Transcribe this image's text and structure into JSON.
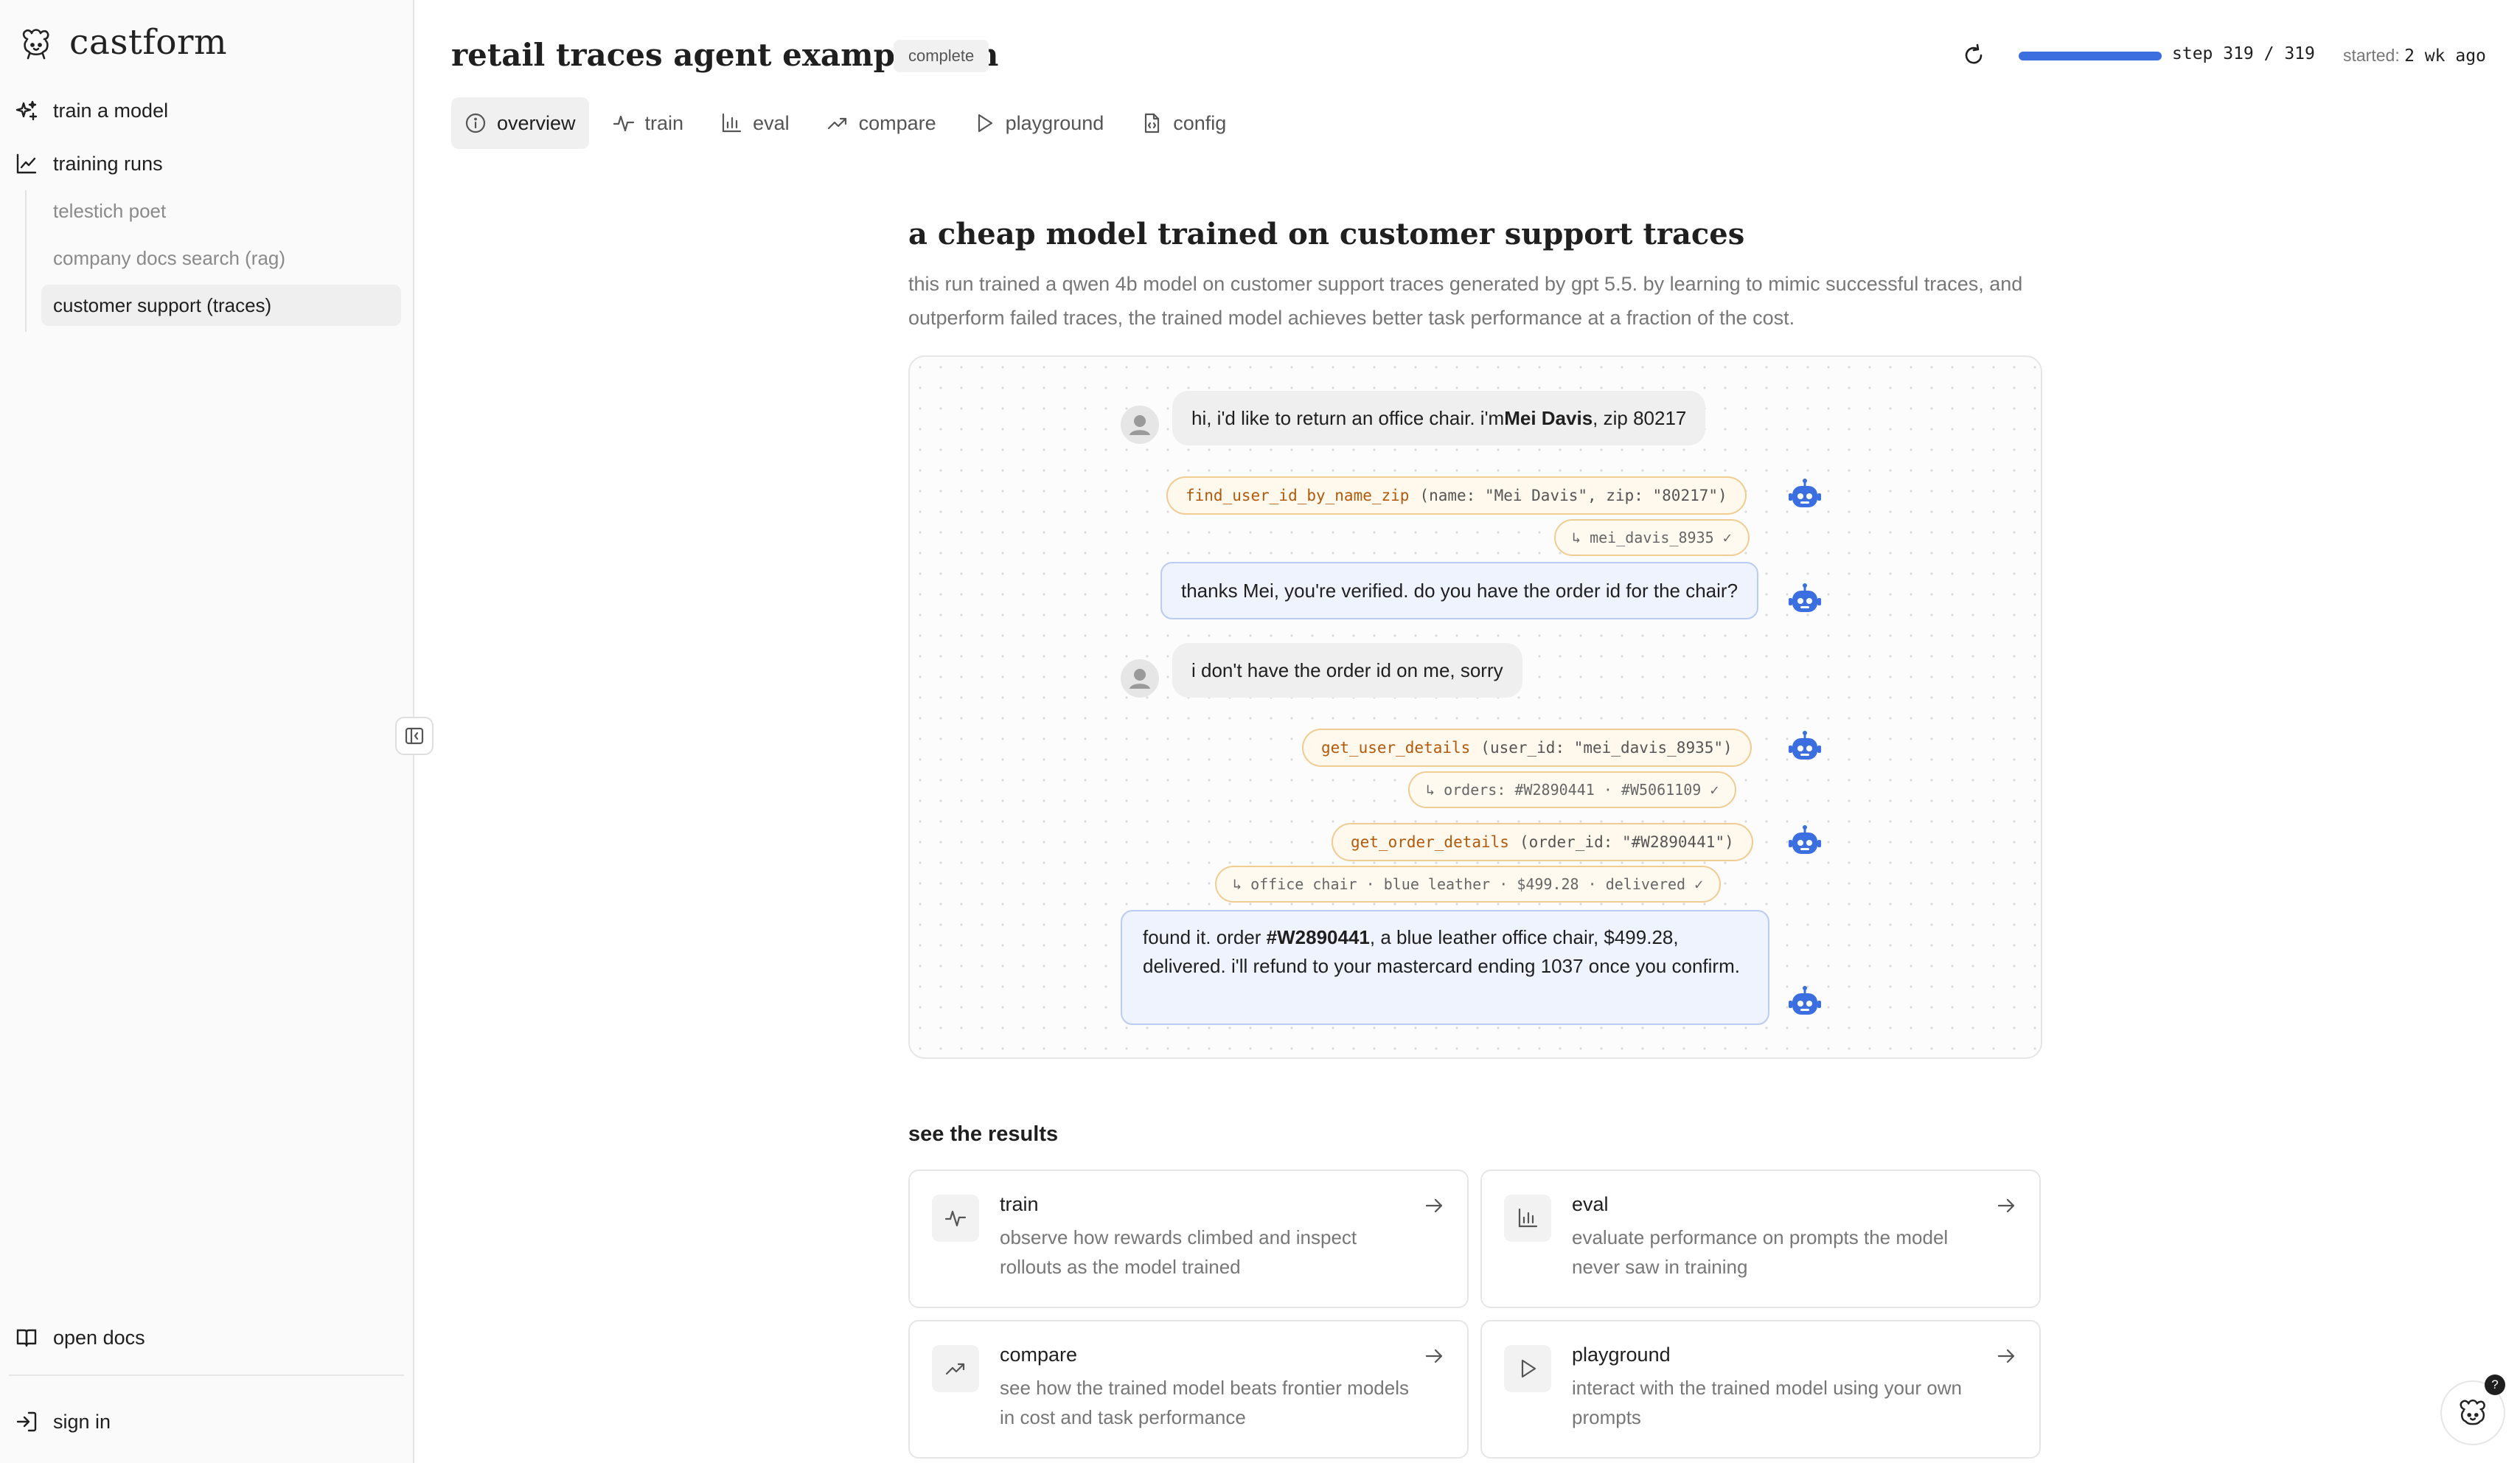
{
  "app": {
    "brand": "castform"
  },
  "sidebar": {
    "nav": [
      {
        "label": "train a model",
        "icon": "sparkle-icon"
      },
      {
        "label": "training runs",
        "icon": "line-chart-icon"
      }
    ],
    "runs": [
      {
        "label": "telestich poet",
        "active": false
      },
      {
        "label": "company docs search (rag)",
        "active": false
      },
      {
        "label": "customer support (traces)",
        "active": true
      }
    ],
    "footer": [
      {
        "label": "open docs",
        "icon": "book-icon"
      },
      {
        "label": "sign in",
        "icon": "sign-in-icon"
      }
    ]
  },
  "header": {
    "title": "retail traces agent example run",
    "status": "complete",
    "progress": {
      "value": 1.0,
      "text": "step 319 / 319"
    },
    "started_label": "started:",
    "started_value": "2 wk ago"
  },
  "tabs": [
    {
      "label": "overview",
      "icon": "info-icon",
      "active": true
    },
    {
      "label": "train",
      "icon": "pulse-icon",
      "active": false
    },
    {
      "label": "eval",
      "icon": "bar-chart-icon",
      "active": false
    },
    {
      "label": "compare",
      "icon": "trend-up-icon",
      "active": false
    },
    {
      "label": "playground",
      "icon": "play-icon",
      "active": false
    },
    {
      "label": "config",
      "icon": "file-code-icon",
      "active": false
    }
  ],
  "overview": {
    "headline": "a cheap model trained on customer support traces",
    "description": "this run trained a qwen 4b model on customer support traces generated by gpt 5.5. by learning to mimic successful traces, and outperform failed traces, the trained model achieves better task performance at a fraction of the cost."
  },
  "conversation": {
    "user1": {
      "pre": "hi, i'd like to return an office chair. i'm ",
      "bold": "Mei Davis",
      "post": ", zip 80217"
    },
    "tool1": {
      "fn": "find_user_id_by_name_zip",
      "args": "(name: \"Mei Davis\", zip: \"80217\")"
    },
    "result1": "↳ mei_davis_8935 ✓",
    "agent1": "thanks Mei, you're verified. do you have the order id for the chair?",
    "user2": "i don't have the order id on me, sorry",
    "tool2": {
      "fn": "get_user_details",
      "args": "(user_id: \"mei_davis_8935\")"
    },
    "result2": "↳ orders: #W2890441 · #W5061109 ✓",
    "tool3": {
      "fn": "get_order_details",
      "args": "(order_id: \"#W2890441\")"
    },
    "result3": "↳ office chair · blue leather · $499.28 · delivered ✓",
    "agent2": {
      "pre": "found it. order ",
      "bold": "#W2890441",
      "post": ", a blue leather office chair, $499.28, delivered. i'll refund to your mastercard ending 1037 once you confirm."
    }
  },
  "results": {
    "title": "see the results",
    "cards": [
      {
        "title": "train",
        "desc": "observe how rewards climbed and inspect rollouts as the model trained",
        "icon": "pulse-icon"
      },
      {
        "title": "eval",
        "desc": "evaluate performance on prompts the model never saw in training",
        "icon": "bar-chart-icon"
      },
      {
        "title": "compare",
        "desc": "see how the trained model beats frontier models in cost and task performance",
        "icon": "trend-up-icon"
      },
      {
        "title": "playground",
        "desc": "interact with the trained model using your own prompts",
        "icon": "play-icon"
      }
    ]
  },
  "help": {
    "badge": "?"
  },
  "colors": {
    "accent": "#3b6fe0",
    "tool_border": "#f0cc93",
    "tool_fn": "#b25a0c",
    "agent_bg": "#eef3fd"
  }
}
